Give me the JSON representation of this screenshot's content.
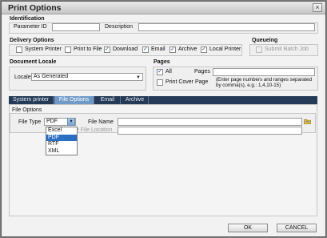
{
  "window": {
    "title": "Print Options",
    "close_glyph": "×"
  },
  "identification": {
    "heading": "Identification",
    "parameter_id_label": "Parameter ID",
    "parameter_id_value": "",
    "description_label": "Description",
    "description_value": ""
  },
  "delivery": {
    "heading": "Delivery Options",
    "options": [
      {
        "label": "System Printer",
        "checked": false
      },
      {
        "label": "Print to File",
        "checked": false
      },
      {
        "label": "Download",
        "checked": true
      },
      {
        "label": "Email",
        "checked": true
      },
      {
        "label": "Archive",
        "checked": true
      },
      {
        "label": "Local Printer",
        "checked": true
      }
    ]
  },
  "queueing": {
    "heading": "Queueing",
    "submit_batch_label": "Submit Batch Job",
    "checked": false,
    "disabled": true
  },
  "locale": {
    "heading": "Document Locale",
    "label": "Locale",
    "value": "As Generated"
  },
  "pages": {
    "heading": "Pages",
    "all_label": "All",
    "all_checked": true,
    "pages_label": "Pages",
    "pages_value": "",
    "print_cover_label": "Print Cover Page",
    "print_cover_checked": false,
    "hint": "(Enter page numbers and ranges separated by comma(s), e.g.: 1,4,10-15)"
  },
  "tabs": [
    {
      "label": "System printer",
      "active": false
    },
    {
      "label": "File Options",
      "active": true
    },
    {
      "label": "Email",
      "active": false
    },
    {
      "label": "Archive",
      "active": false
    }
  ],
  "file_options": {
    "heading": "File Options",
    "file_type_label": "File Type",
    "file_type_value": "PDF",
    "file_type_options": [
      "Excel",
      "PDF",
      "RTF",
      "XML"
    ],
    "file_type_selected": "PDF",
    "file_name_label": "File Name",
    "file_name_value": "",
    "remote_location_label": "te File Location",
    "remote_location_value": ""
  },
  "buttons": {
    "ok": "OK",
    "cancel": "CANCEL"
  },
  "colors": {
    "tab_bar": "#243a56",
    "tab_active": "#6f9ac8",
    "dropdown_selected": "#2b6fc2"
  }
}
